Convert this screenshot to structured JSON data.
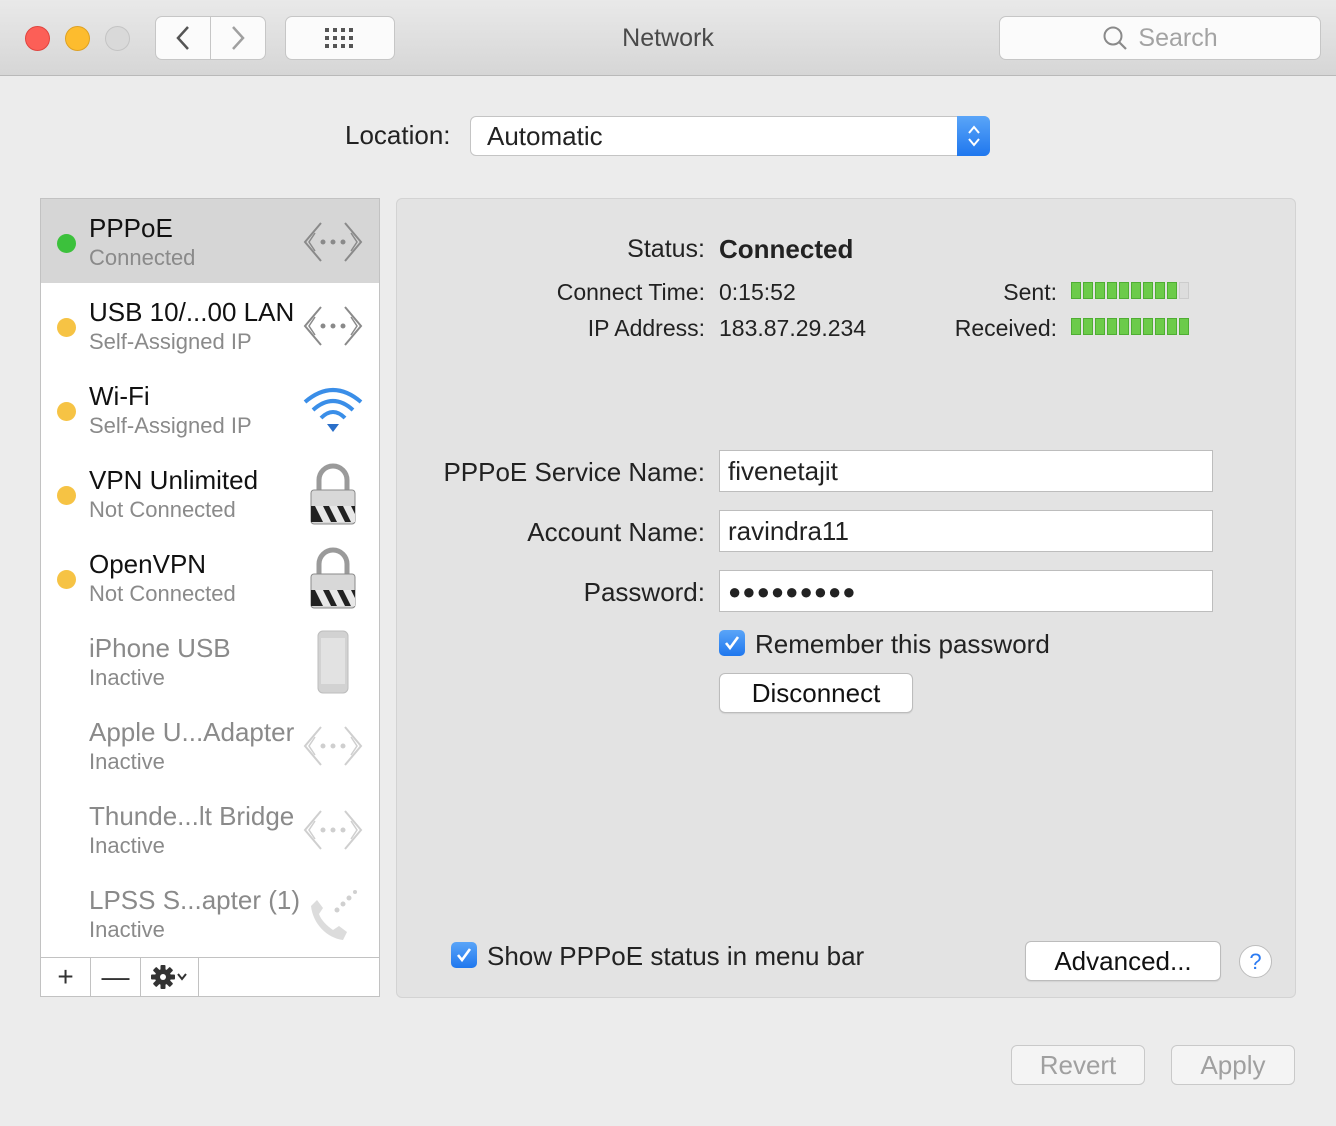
{
  "window": {
    "title": "Network",
    "search_placeholder": "Search"
  },
  "location": {
    "label": "Location:",
    "value": "Automatic"
  },
  "services": [
    {
      "name": "PPPoE",
      "status": "Connected",
      "dot": "green",
      "icon": "ethernet-icon",
      "selected": true
    },
    {
      "name": "USB 10/...00 LAN",
      "status": "Self-Assigned IP",
      "dot": "yellow",
      "icon": "ethernet-icon"
    },
    {
      "name": "Wi-Fi",
      "status": "Self-Assigned IP",
      "dot": "yellow",
      "icon": "wifi-icon"
    },
    {
      "name": "VPN Unlimited",
      "status": "Not Connected",
      "dot": "yellow",
      "icon": "lock-icon"
    },
    {
      "name": "OpenVPN",
      "status": "Not Connected",
      "dot": "yellow",
      "icon": "lock-icon"
    },
    {
      "name": "iPhone USB",
      "status": "Inactive",
      "dot": "none",
      "icon": "iphone-icon"
    },
    {
      "name": "Apple U...Adapter",
      "status": "Inactive",
      "dot": "none",
      "icon": "ethernet-icon"
    },
    {
      "name": "Thunde...lt Bridge",
      "status": "Inactive",
      "dot": "none",
      "icon": "ethernet-icon"
    },
    {
      "name": "LPSS S...apter (1)",
      "status": "Inactive",
      "dot": "none",
      "icon": "phone-icon"
    }
  ],
  "sidebar_toolbar": {
    "add": "+",
    "remove": "—"
  },
  "detail": {
    "status_label": "Status:",
    "status_value": "Connected",
    "connect_time_label": "Connect Time:",
    "connect_time_value": "0:15:52",
    "ip_label": "IP Address:",
    "ip_value": "183.87.29.234",
    "sent_label": "Sent:",
    "received_label": "Received:",
    "sent_level_segments": 9,
    "received_level_segments": 10,
    "meter_total_segments": 10,
    "service_name_label": "PPPoE Service Name:",
    "service_name_value": "fivenetajit",
    "account_name_label": "Account Name:",
    "account_name_value": "ravindra11",
    "password_label": "Password:",
    "password_value": "●●●●●●●●●",
    "remember_label": "Remember this password",
    "remember_checked": true,
    "disconnect_label": "Disconnect",
    "show_status_label": "Show PPPoE status in menu bar",
    "show_status_checked": true,
    "advanced_label": "Advanced...",
    "help_label": "?"
  },
  "footer": {
    "revert_label": "Revert",
    "apply_label": "Apply"
  },
  "colors": {
    "green_dot": "#3cc13c",
    "yellow_dot": "#f6c344",
    "accent": "#2a7af2",
    "meter_green": "#6ccb4a"
  }
}
